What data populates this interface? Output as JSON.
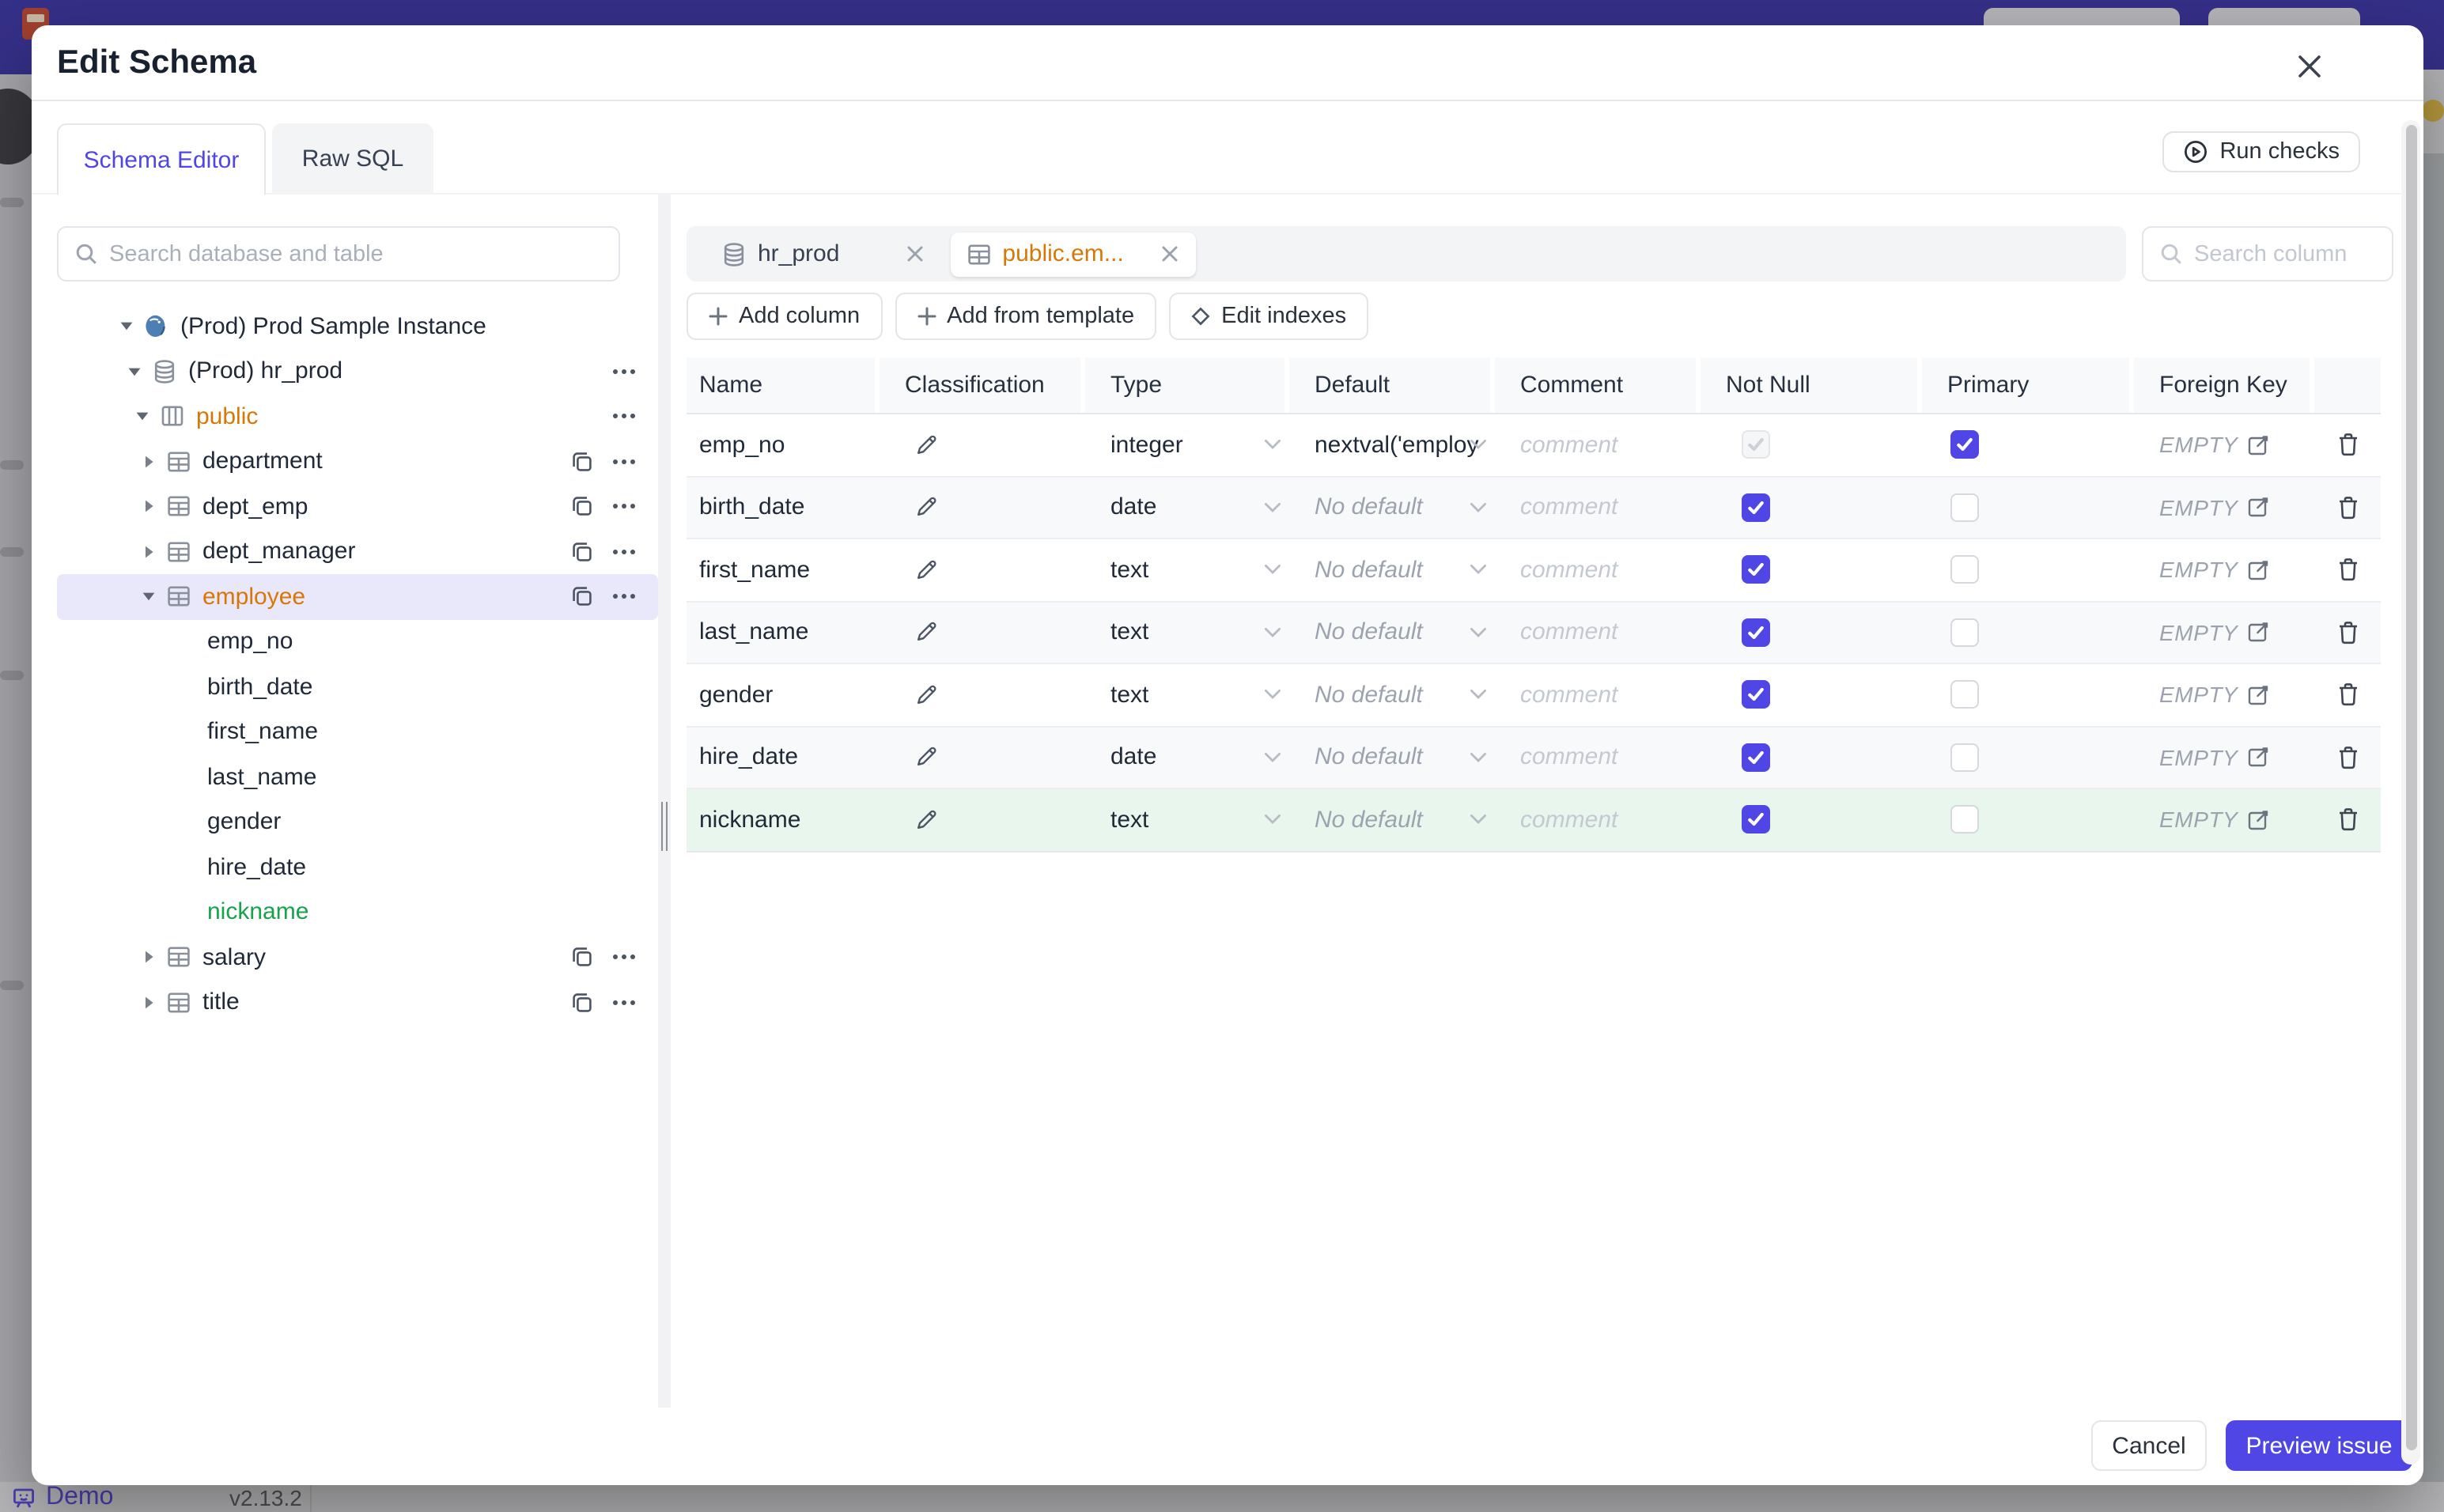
{
  "background": {
    "demo_label": "Demo",
    "version": "v2.13.2"
  },
  "modal": {
    "title": "Edit Schema",
    "tabs": [
      {
        "label": "Schema Editor",
        "active": true
      },
      {
        "label": "Raw SQL",
        "active": false
      }
    ],
    "run_checks_label": "Run checks",
    "footer": {
      "cancel_label": "Cancel",
      "primary_label": "Preview issue"
    }
  },
  "sidebar": {
    "search_placeholder": "Search database and table",
    "tree": [
      {
        "label": "(Prod) Prod Sample Instance",
        "kind": "instance",
        "level": 0,
        "caret": "down"
      },
      {
        "label": "(Prod) hr_prod",
        "kind": "database",
        "level": 1,
        "caret": "down",
        "menu": true
      },
      {
        "label": "public",
        "kind": "schema",
        "level": 2,
        "caret": "down",
        "menu": true,
        "color": "amber"
      },
      {
        "label": "department",
        "kind": "table",
        "level": 3,
        "caret": "right",
        "copy": true,
        "menu": true
      },
      {
        "label": "dept_emp",
        "kind": "table",
        "level": 3,
        "caret": "right",
        "copy": true,
        "menu": true
      },
      {
        "label": "dept_manager",
        "kind": "table",
        "level": 3,
        "caret": "right",
        "copy": true,
        "menu": true
      },
      {
        "label": "employee",
        "kind": "table",
        "level": 3,
        "caret": "down",
        "copy": true,
        "menu": true,
        "color": "amber",
        "selected": true
      },
      {
        "label": "emp_no",
        "kind": "column",
        "level": 4
      },
      {
        "label": "birth_date",
        "kind": "column",
        "level": 4
      },
      {
        "label": "first_name",
        "kind": "column",
        "level": 4
      },
      {
        "label": "last_name",
        "kind": "column",
        "level": 4
      },
      {
        "label": "gender",
        "kind": "column",
        "level": 4
      },
      {
        "label": "hire_date",
        "kind": "column",
        "level": 4
      },
      {
        "label": "nickname",
        "kind": "column",
        "level": 4,
        "color": "green"
      },
      {
        "label": "salary",
        "kind": "table",
        "level": 3,
        "caret": "right",
        "copy": true,
        "menu": true
      },
      {
        "label": "title",
        "kind": "table",
        "level": 3,
        "caret": "right",
        "copy": true,
        "menu": true
      }
    ]
  },
  "editor": {
    "chips": [
      {
        "label": "hr_prod",
        "kind": "database",
        "active": false
      },
      {
        "label": "public.em...",
        "kind": "table",
        "active": true
      }
    ],
    "column_search_placeholder": "Search column",
    "toolbar": [
      {
        "label": "Add column"
      },
      {
        "label": "Add from template"
      },
      {
        "label": "Edit indexes"
      }
    ],
    "table": {
      "headers": [
        "Name",
        "Classification",
        "Type",
        "Default",
        "Comment",
        "Not Null",
        "Primary",
        "Foreign Key"
      ],
      "comment_placeholder": "comment",
      "foreign_key_empty": "EMPTY",
      "rows": [
        {
          "name": "emp_no",
          "type": "integer",
          "default": "nextval('employ",
          "default_set": true,
          "not_null_checked": true,
          "not_null_disabled": true,
          "primary": true,
          "new": false
        },
        {
          "name": "birth_date",
          "type": "date",
          "default": "No default",
          "default_set": false,
          "not_null_checked": true,
          "not_null_disabled": false,
          "primary": false,
          "new": false
        },
        {
          "name": "first_name",
          "type": "text",
          "default": "No default",
          "default_set": false,
          "not_null_checked": true,
          "not_null_disabled": false,
          "primary": false,
          "new": false
        },
        {
          "name": "last_name",
          "type": "text",
          "default": "No default",
          "default_set": false,
          "not_null_checked": true,
          "not_null_disabled": false,
          "primary": false,
          "new": false
        },
        {
          "name": "gender",
          "type": "text",
          "default": "No default",
          "default_set": false,
          "not_null_checked": true,
          "not_null_disabled": false,
          "primary": false,
          "new": false
        },
        {
          "name": "hire_date",
          "type": "date",
          "default": "No default",
          "default_set": false,
          "not_null_checked": true,
          "not_null_disabled": false,
          "primary": false,
          "new": false
        },
        {
          "name": "nickname",
          "type": "text",
          "default": "No default",
          "default_set": false,
          "not_null_checked": true,
          "not_null_disabled": false,
          "primary": false,
          "new": true
        }
      ]
    }
  },
  "colors": {
    "accent": "#4f46e5",
    "amber": "#d97706",
    "green": "#16a34a",
    "new_row_bg": "#e8f6ee",
    "selected_tree_bg": "#e9e8fb",
    "banner": "#353088"
  }
}
